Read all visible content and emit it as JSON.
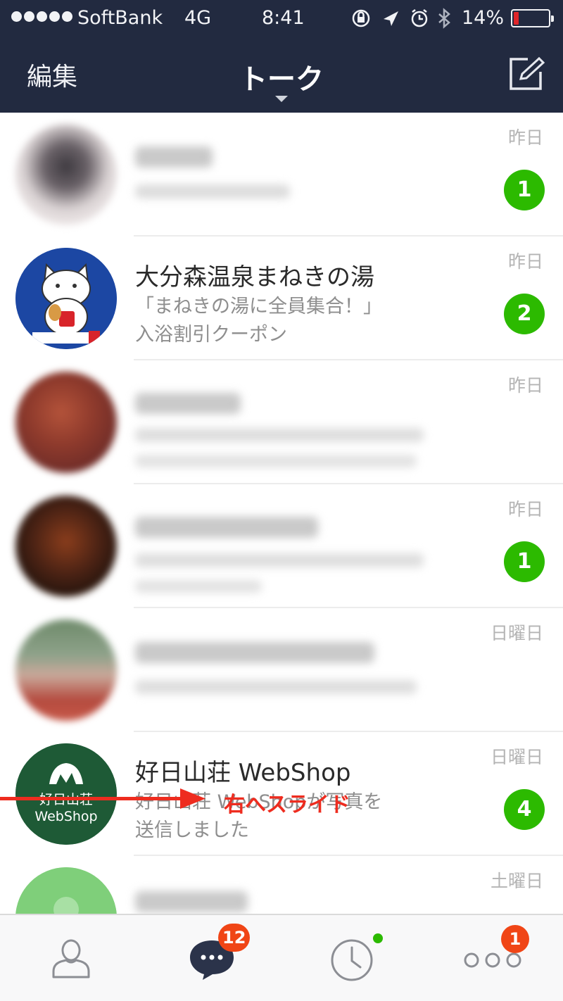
{
  "status_bar": {
    "carrier": "SoftBank",
    "network": "4G",
    "time": "8:41",
    "battery_percent": "14%",
    "battery_level": 0.14,
    "battery_color": "#e0262a",
    "icons": [
      "orientation-lock-icon",
      "location-arrow-icon",
      "alarm-icon",
      "bluetooth-icon"
    ]
  },
  "nav": {
    "edit_label": "編集",
    "title": "トーク",
    "compose_icon": "compose-icon"
  },
  "colors": {
    "header_bg": "#222a40",
    "unread_badge": "#2cba00",
    "tab_badge": "#f04516",
    "annotation": "#ee2c1f"
  },
  "talks": [
    {
      "name": "",
      "preview": "",
      "date": "昨日",
      "unread": "1",
      "obscured": true
    },
    {
      "name": "大分森温泉まねきの湯",
      "preview": "「まねきの湯に全員集合！」\n入浴割引クーポン",
      "date": "昨日",
      "unread": "2",
      "obscured": false
    },
    {
      "name": "",
      "preview": "",
      "date": "昨日",
      "unread": "",
      "obscured": true
    },
    {
      "name": "",
      "preview": "",
      "date": "昨日",
      "unread": "1",
      "obscured": true
    },
    {
      "name": "",
      "preview": "",
      "date": "日曜日",
      "unread": "",
      "obscured": true
    },
    {
      "name": "好日山荘 WebShop",
      "preview": "好日山荘 WebShopが写真を\n送信しました",
      "date": "日曜日",
      "unread": "4",
      "obscured": false,
      "avatar_text": [
        "好日山荘",
        "WebShop"
      ]
    },
    {
      "name": "",
      "preview": "",
      "date": "土曜日",
      "unread": "",
      "obscured": true
    }
  ],
  "annotation": {
    "label": "右へスライド"
  },
  "tabbar": {
    "items": [
      {
        "icon": "friends-icon",
        "badge": ""
      },
      {
        "icon": "chats-icon",
        "badge": "12",
        "selected": true
      },
      {
        "icon": "timeline-icon",
        "badge": "",
        "dot": true
      },
      {
        "icon": "more-icon",
        "badge": "1"
      }
    ]
  }
}
